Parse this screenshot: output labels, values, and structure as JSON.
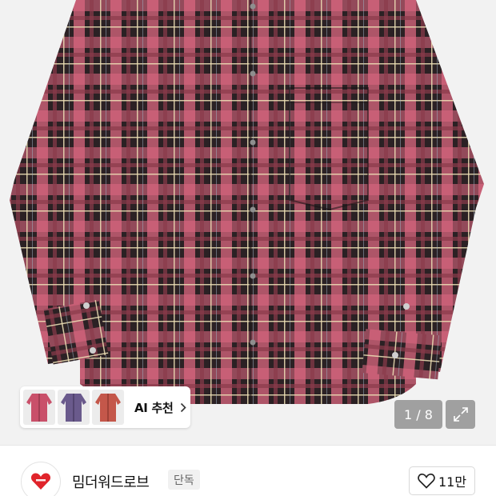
{
  "product_image": {
    "alt": "red plaid flannel shirt",
    "page_current": "1 / 8"
  },
  "ai_recommend": {
    "label": "AI 추천",
    "thumbnails": [
      {
        "name": "pink plaid shirt",
        "color": "#c9506a"
      },
      {
        "name": "purple plaid shirt",
        "color": "#6a5a8c"
      },
      {
        "name": "red plaid shirt",
        "color": "#c4574a"
      }
    ]
  },
  "brand": {
    "name": "밈더워드로브",
    "badge": "단독",
    "logo_color": "#e0242b"
  },
  "like": {
    "count": "11만"
  },
  "icons": {
    "expand": "expand-arrows-icon",
    "heart": "heart-outline-icon",
    "chevron": "chevron-right-icon"
  }
}
